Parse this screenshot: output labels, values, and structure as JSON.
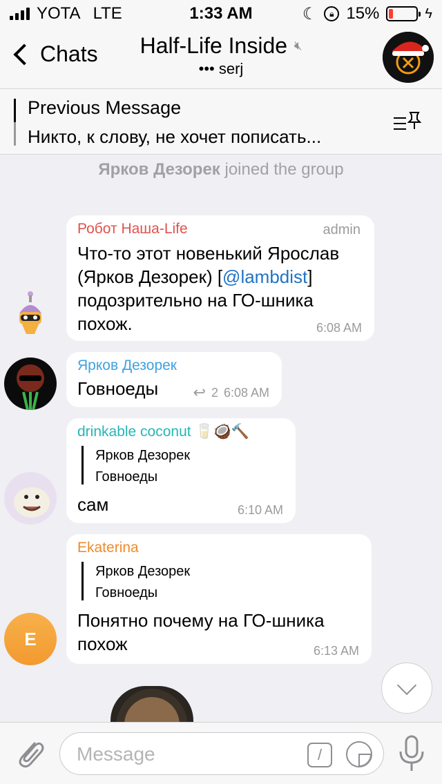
{
  "status_bar": {
    "carrier": "YOTA",
    "network": "LTE",
    "time": "1:33 AM",
    "battery": "15%",
    "battery_level": 0.15
  },
  "header": {
    "back_label": "Chats",
    "title": "Half-Life Inside",
    "subtitle": "••• serj"
  },
  "pinned": {
    "title": "Previous Message",
    "text": "Никто, к слову, не хочет пописать..."
  },
  "service": {
    "name": "Ярков Дезорек",
    "text": " joined the group"
  },
  "messages": [
    {
      "sender": "Робот Наша-Life",
      "sender_color": "#e0524c",
      "badge": "admin",
      "text_before": "Что-то этот новенький Ярослав (Ярков Дезорек) [",
      "link": "@lambdist",
      "text_after": "] подозрительно на ГО-шника похож.",
      "time": "6:08 AM"
    },
    {
      "sender": "Ярков Дезорек",
      "sender_color": "#3fa1e0",
      "text": "Говноеды",
      "forwards": "2",
      "time": "6:08 AM"
    },
    {
      "sender": "drinkable coconut 🥛🥥🔨",
      "sender_color": "#26b6b6",
      "reply_name": "Ярков Дезорек",
      "reply_text": "Говноеды",
      "text": "сам",
      "time": "6:10 AM"
    },
    {
      "sender": "Ekaterina",
      "sender_color": "#ef8a2b",
      "reply_name": "Ярков Дезорек",
      "reply_text": "Говноеды",
      "text": "Понятно почему на ГО-шника похож",
      "time": "6:13 AM",
      "avatar_letter": "E"
    }
  ],
  "input": {
    "placeholder": "Message",
    "command_glyph": "/"
  }
}
